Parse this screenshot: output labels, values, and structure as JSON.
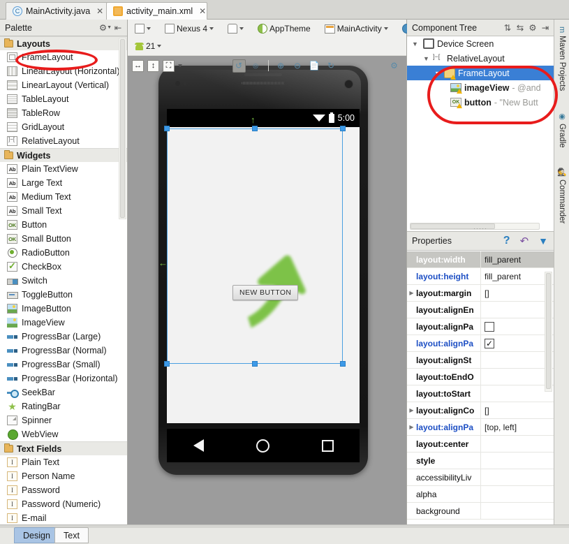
{
  "editor_tabs": [
    {
      "label": "MainActivity.java",
      "icon": "java-class-icon",
      "active": false,
      "close": "✕"
    },
    {
      "label": "activity_main.xml",
      "icon": "xml-file-icon",
      "active": true,
      "close": "✕"
    }
  ],
  "palette": {
    "title": "Palette",
    "header_icons": [
      "gear-icon",
      "collapse-icon"
    ],
    "groups": [
      {
        "label": "Layouts",
        "items": [
          {
            "label": "FrameLayout",
            "icon": "framelayout-icon",
            "highlighted": true
          },
          {
            "label": "LinearLayout (Horizontal)",
            "icon": "linearlayout-horizontal-icon"
          },
          {
            "label": "LinearLayout (Vertical)",
            "icon": "linearlayout-vertical-icon"
          },
          {
            "label": "TableLayout",
            "icon": "tablelayout-icon"
          },
          {
            "label": "TableRow",
            "icon": "tablerow-icon"
          },
          {
            "label": "GridLayout",
            "icon": "gridlayout-icon"
          },
          {
            "label": "RelativeLayout",
            "icon": "relativelayout-icon"
          }
        ]
      },
      {
        "label": "Widgets",
        "items": [
          {
            "label": "Plain TextView",
            "icon": "textview-icon"
          },
          {
            "label": "Large Text",
            "icon": "textview-icon"
          },
          {
            "label": "Medium Text",
            "icon": "textview-icon"
          },
          {
            "label": "Small Text",
            "icon": "textview-icon"
          },
          {
            "label": "Button",
            "icon": "button-icon"
          },
          {
            "label": "Small Button",
            "icon": "button-icon"
          },
          {
            "label": "RadioButton",
            "icon": "radiobutton-icon"
          },
          {
            "label": "CheckBox",
            "icon": "checkbox-icon"
          },
          {
            "label": "Switch",
            "icon": "switch-icon"
          },
          {
            "label": "ToggleButton",
            "icon": "togglebutton-icon"
          },
          {
            "label": "ImageButton",
            "icon": "imagebutton-icon"
          },
          {
            "label": "ImageView",
            "icon": "imageview-icon"
          },
          {
            "label": "ProgressBar (Large)",
            "icon": "progressbar-icon"
          },
          {
            "label": "ProgressBar (Normal)",
            "icon": "progressbar-icon"
          },
          {
            "label": "ProgressBar (Small)",
            "icon": "progressbar-icon"
          },
          {
            "label": "ProgressBar (Horizontal)",
            "icon": "progressbar-icon"
          },
          {
            "label": "SeekBar",
            "icon": "seekbar-icon"
          },
          {
            "label": "RatingBar",
            "icon": "ratingbar-icon"
          },
          {
            "label": "Spinner",
            "icon": "spinner-icon"
          },
          {
            "label": "WebView",
            "icon": "webview-icon"
          }
        ]
      },
      {
        "label": "Text Fields",
        "items": [
          {
            "label": "Plain Text",
            "icon": "textfield-icon"
          },
          {
            "label": "Person Name",
            "icon": "textfield-icon"
          },
          {
            "label": "Password",
            "icon": "textfield-icon"
          },
          {
            "label": "Password (Numeric)",
            "icon": "textfield-icon"
          },
          {
            "label": "E-mail",
            "icon": "textfield-icon"
          }
        ]
      }
    ]
  },
  "design_toolbar": {
    "row1": [
      {
        "label": "",
        "icon": "device-config-icon",
        "caret": true
      },
      {
        "label": "Nexus 4",
        "icon": "device-icon",
        "caret": true
      },
      {
        "label": "",
        "icon": "orientation-icon",
        "caret": true
      },
      {
        "label": "AppTheme",
        "icon": "theme-icon",
        "caret": false
      },
      {
        "label": "MainActivity",
        "icon": "activity-icon",
        "caret": true
      },
      {
        "label": "",
        "icon": "locale-globe-icon",
        "caret": true
      }
    ],
    "api_level": {
      "label": "21",
      "icon": "android-api-icon",
      "caret": true
    },
    "row2_left": [
      {
        "icon": "fit-width-icon",
        "label": "↔"
      },
      {
        "icon": "fit-height-icon",
        "label": "↕"
      },
      {
        "icon": "zoom-to-fit-icon",
        "label": "⤢"
      }
    ],
    "row2_right": [
      {
        "icon": "refresh-render-icon",
        "selected": true
      },
      {
        "icon": "zoom-actual-size-icon",
        "label": "1:1"
      },
      {
        "icon": "zoom-in-icon",
        "label": "+"
      },
      {
        "icon": "zoom-out-icon",
        "label": "−"
      },
      {
        "icon": "document-icon"
      },
      {
        "icon": "refresh-icon"
      },
      {
        "icon": "gear-icon"
      }
    ]
  },
  "preview": {
    "device_name": "Nexus 4",
    "status_bar": {
      "clock": "5:00",
      "wifi_icon": "wifi-icon",
      "battery_icon": "battery-icon"
    },
    "button_label": "NEW BUTTON",
    "image_icon": "phone-call-icon",
    "nav_bar": [
      "back-nav-icon",
      "home-nav-icon",
      "recents-nav-icon"
    ]
  },
  "component_tree": {
    "title": "Component Tree",
    "header_icons": [
      "expand-all-icon",
      "collapse-all-icon",
      "gear-icon",
      "hide-icon"
    ],
    "nodes": [
      {
        "label": "Device Screen",
        "value": "",
        "icon": "device-screen-icon",
        "indent": 0,
        "expanded": true,
        "selected": false,
        "warning": false
      },
      {
        "label": "RelativeLayout",
        "value": "",
        "icon": "relativelayout-icon",
        "indent": 1,
        "expanded": true,
        "selected": false,
        "warning": false
      },
      {
        "label": "FrameLayout",
        "value": "",
        "icon": "framelayout-icon",
        "indent": 2,
        "expanded": true,
        "selected": true,
        "warning": true
      },
      {
        "label": "imageView",
        "value": "- @and",
        "icon": "imageview-icon",
        "indent": 3,
        "expanded": false,
        "selected": false,
        "warning": true
      },
      {
        "label": "button",
        "value": "- \"New Butt",
        "icon": "button-icon",
        "indent": 3,
        "expanded": false,
        "selected": false,
        "warning": true
      }
    ]
  },
  "properties": {
    "title": "Properties",
    "header_icons": [
      "help-icon",
      "reset-icon",
      "filter-icon"
    ],
    "rows": [
      {
        "name": "layout:width",
        "value": "fill_parent",
        "type": "text",
        "expandable": false,
        "selected": true,
        "modified": false
      },
      {
        "name": "layout:height",
        "value": "fill_parent",
        "type": "text",
        "expandable": false,
        "selected": false,
        "modified": true
      },
      {
        "name": "layout:margin",
        "value": "[]",
        "type": "text",
        "expandable": true,
        "selected": false,
        "modified": false
      },
      {
        "name": "layout:alignEn",
        "value": "",
        "type": "text",
        "expandable": false,
        "selected": false,
        "modified": false
      },
      {
        "name": "layout:alignPa",
        "value": "",
        "type": "checkbox",
        "checked": false,
        "expandable": false,
        "selected": false,
        "modified": false
      },
      {
        "name": "layout:alignPa",
        "value": "",
        "type": "checkbox",
        "checked": true,
        "expandable": false,
        "selected": false,
        "modified": true
      },
      {
        "name": "layout:alignSt",
        "value": "",
        "type": "text",
        "expandable": false,
        "selected": false,
        "modified": false
      },
      {
        "name": "layout:toEndO",
        "value": "",
        "type": "text",
        "expandable": false,
        "selected": false,
        "modified": false
      },
      {
        "name": "layout:toStart",
        "value": "",
        "type": "text",
        "expandable": false,
        "selected": false,
        "modified": false
      },
      {
        "name": "layout:alignCo",
        "value": "[]",
        "type": "text",
        "expandable": true,
        "selected": false,
        "modified": false
      },
      {
        "name": "layout:alignPa",
        "value": "[top, left]",
        "type": "text",
        "expandable": true,
        "selected": false,
        "modified": true
      },
      {
        "name": "layout:center",
        "value": "",
        "type": "text",
        "expandable": false,
        "selected": false,
        "modified": false
      },
      {
        "name": "style",
        "value": "",
        "type": "text",
        "expandable": false,
        "selected": false,
        "modified": false
      },
      {
        "name": "accessibilityLiv",
        "value": "",
        "type": "text",
        "expandable": false,
        "selected": false,
        "modified": false
      },
      {
        "name": "alpha",
        "value": "",
        "type": "text",
        "expandable": false,
        "selected": false,
        "modified": false
      },
      {
        "name": "background",
        "value": "",
        "type": "text",
        "expandable": false,
        "selected": false,
        "modified": false
      }
    ]
  },
  "tool_tabs_right": [
    {
      "label": "Maven Projects",
      "icon": "maven-icon"
    },
    {
      "label": "Gradle",
      "icon": "gradle-icon"
    },
    {
      "label": "Commander",
      "icon": "commander-icon"
    }
  ],
  "bottom_tabs": [
    {
      "label": "Design",
      "active": true
    },
    {
      "label": "Text",
      "active": false
    }
  ],
  "annotations": {
    "color": "#e81c1c",
    "rings": [
      {
        "target": "palette-item-framelayout"
      },
      {
        "target": "component-tree-framelayout-subtree"
      }
    ]
  }
}
